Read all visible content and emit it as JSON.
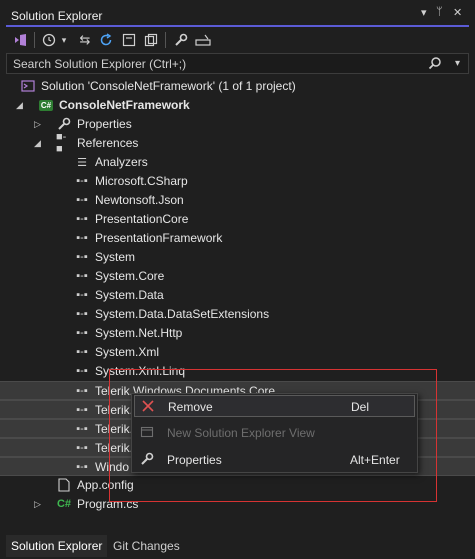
{
  "window": {
    "title": "Solution Explorer",
    "controls": [
      "chevron-down-icon",
      "pin-icon",
      "close-icon"
    ]
  },
  "toolbar": {
    "icons": [
      "vs-switch-views-icon",
      "history-icon",
      "chevron-down-icon",
      "sync-icon",
      "refresh-icon",
      "collapse-all-icon",
      "show-all-files-icon",
      "properties-wrench-icon",
      "preview-icon"
    ]
  },
  "search": {
    "placeholder": "Search Solution Explorer (Ctrl+;)"
  },
  "tree": {
    "solution": "Solution 'ConsoleNetFramework' (1 of 1 project)",
    "project": "ConsoleNetFramework",
    "properties": "Properties",
    "references": "References",
    "analyzers": "Analyzers",
    "refs": [
      "Microsoft.CSharp",
      "Newtonsoft.Json",
      "PresentationCore",
      "PresentationFramework",
      "System",
      "System.Core",
      "System.Data",
      "System.Data.DataSetExtensions",
      "System.Net.Http",
      "System.Xml",
      "System.Xml.Linq",
      "Telerik.Windows.Documents.Core",
      "Telerik.",
      "Telerik.",
      "Telerik.",
      "Windo"
    ],
    "app_config": "App.config",
    "program_cs": "Program.cs"
  },
  "context_menu": {
    "remove": "Remove",
    "remove_shortcut": "Del",
    "new_view": "New Solution Explorer View",
    "properties": "Properties",
    "properties_shortcut": "Alt+Enter"
  },
  "bottom_tabs": [
    "Solution Explorer",
    "Git Changes"
  ],
  "colors": {
    "accent": "#5b5bd6",
    "csharp": "#2e7d32",
    "highlight_box": "#d63333"
  }
}
